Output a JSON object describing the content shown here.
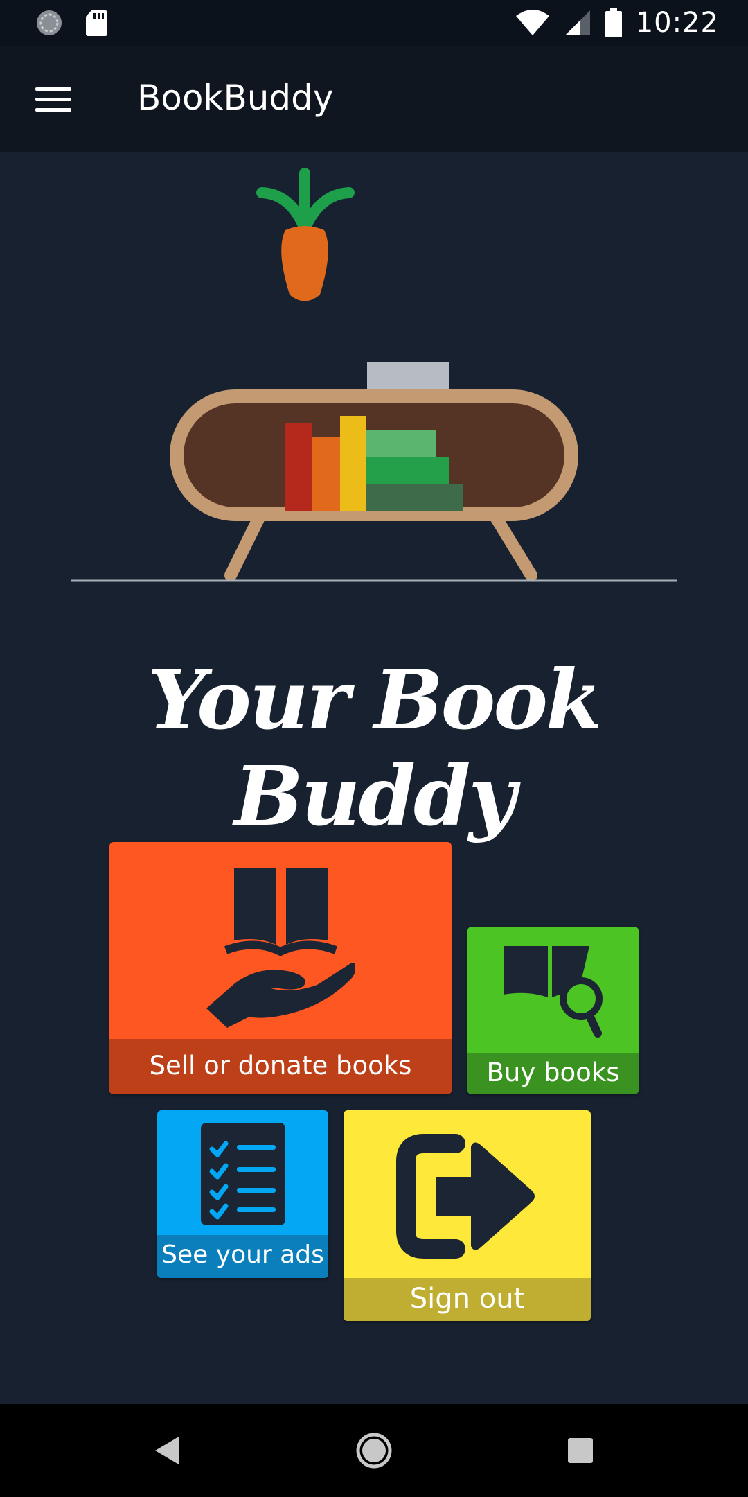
{
  "status_bar": {
    "time": "10:22",
    "icons": [
      "sync-icon",
      "sd-card-icon",
      "wifi-icon",
      "signal-icon",
      "battery-icon"
    ]
  },
  "app_bar": {
    "title": "BookBuddy",
    "menu_icon": "hamburger-menu-icon"
  },
  "hero": {
    "tagline": "Your Book Buddy"
  },
  "tiles": {
    "sell": {
      "label": "Sell or donate books",
      "icon": "book-in-hand-icon",
      "color": "#fe5722"
    },
    "buy": {
      "label": "Buy books",
      "icon": "book-search-icon",
      "color": "#4cc423"
    },
    "ads": {
      "label": "See your ads",
      "icon": "checklist-icon",
      "color": "#04a7f3"
    },
    "signout": {
      "label": "Sign out",
      "icon": "sign-out-arrow-icon",
      "color": "#fee93b"
    }
  },
  "nav_bar": {
    "icons": [
      "back-icon",
      "home-icon",
      "recents-icon"
    ]
  },
  "colors": {
    "background": "#172130",
    "app_bar": "#0f1620",
    "status_bar": "#0c121b"
  }
}
